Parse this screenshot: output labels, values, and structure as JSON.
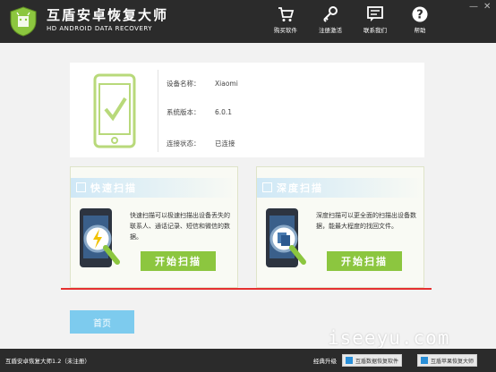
{
  "app": {
    "title": "互盾安卓恢复大师",
    "subtitle": "HD ANDROID DATA RECOVERY"
  },
  "nav": [
    {
      "label": "购买软件",
      "icon": "cart-icon"
    },
    {
      "label": "注册激活",
      "icon": "key-icon"
    },
    {
      "label": "联系我们",
      "icon": "chat-icon"
    },
    {
      "label": "帮助",
      "icon": "help-icon"
    }
  ],
  "window_controls": {
    "minimize": "—",
    "close": "✕"
  },
  "device": {
    "name_label": "设备名称：",
    "name_value": "Xiaomi",
    "version_label": "系统版本：",
    "version_value": "6.0.1",
    "status_label": "连接状态：",
    "status_value": "已连接"
  },
  "quick_scan": {
    "title": "快速扫描",
    "description": "快速扫描可以极速扫描出设备丢失的联系人、通话记录、短信和微信的数据。",
    "button": "开始扫描"
  },
  "deep_scan": {
    "title": "深度扫描",
    "description": "深度扫描可以更全面的扫描出设备数据，能最大程度的找回文件。",
    "button": "开始扫描"
  },
  "home_button": "首页",
  "footer": {
    "version": "互盾安卓恢复大师1.2（未注册）",
    "recommend": "经典升级",
    "btn1": "互盾数据恢复软件",
    "btn2": "互盾苹果恢复大师"
  },
  "watermark": "iseeyu.com",
  "colors": {
    "header_bg": "#2b2b2b",
    "accent_green": "#8cc63f",
    "accent_blue": "#7dcbee",
    "divider_red": "#e53030"
  }
}
